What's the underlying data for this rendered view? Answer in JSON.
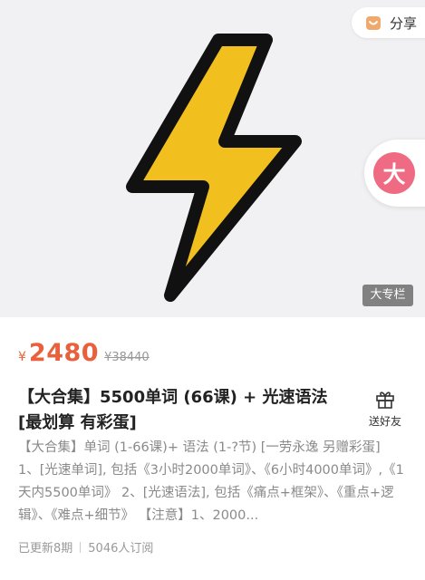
{
  "hero": {
    "image": "lightning-bolt-icon",
    "colors": {
      "bolt_fill": "#f2c01e",
      "bolt_outline": "#111111",
      "background": "#f1f1f3"
    }
  },
  "share": {
    "label": "分享",
    "icon": "share-bag-icon",
    "icon_color": "#f0a86b"
  },
  "brand": {
    "glyph": "大",
    "color": "#ef6a83"
  },
  "column_tag": "大专栏",
  "price": {
    "currency": "¥",
    "current": "2480",
    "original": "¥38440",
    "color": "#e8613c"
  },
  "title": "【大合集】5500单词 (66课) + 光速语法 [最划算 有彩蛋]",
  "gift": {
    "label": "送好友",
    "icon": "gift-icon"
  },
  "description": "【大合集】单词 (1-66课)+ 语法 (1-?节) [一劳永逸 另赠彩蛋] 1、[光速单词], 包括《3小时2000单词》、《6小时4000单词》,《1天内5500单词》 2、[光速语法], 包括《痛点+框架》、《重点+逻辑》、《难点+细节》 【注意】1、2000...",
  "meta": {
    "updated": "已更新8期",
    "subscribers": "5046人订阅"
  }
}
